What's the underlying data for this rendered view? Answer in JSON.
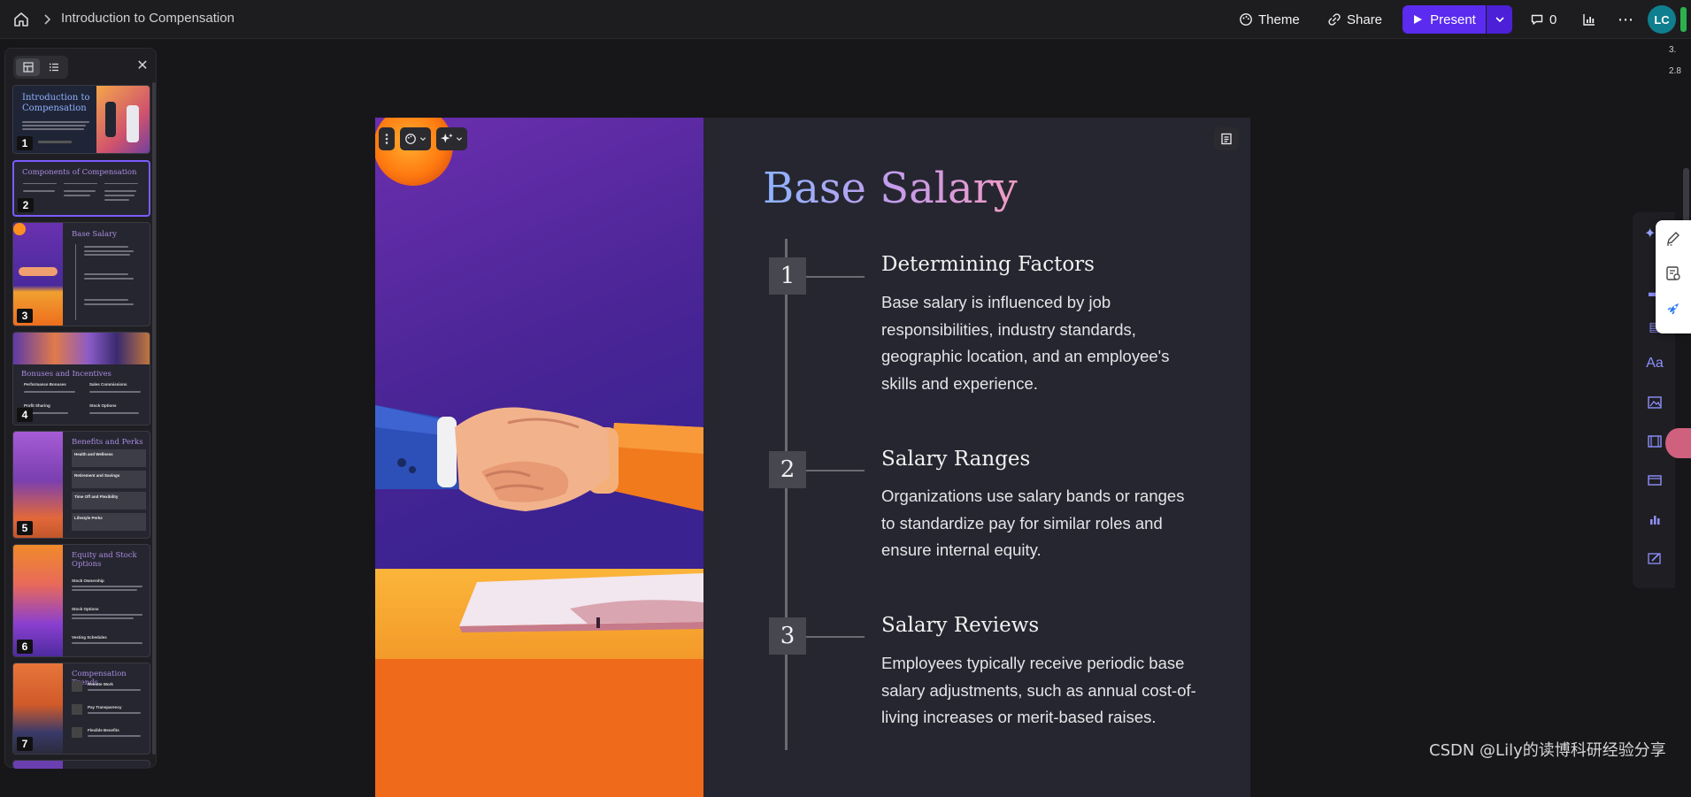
{
  "app": {
    "breadcrumb_title": "Introduction to Compensation",
    "theme_label": "Theme",
    "share_label": "Share",
    "present_label": "Present",
    "comments_count": "0",
    "avatar_initials": "LC",
    "accent_color": "#5b2bef",
    "mini_stats": [
      "3.",
      "2.8"
    ]
  },
  "sidebar": {
    "slides": [
      {
        "number": "1",
        "title": "Introduction to Compensation"
      },
      {
        "number": "2",
        "title": "Components of Compensation"
      },
      {
        "number": "3",
        "title": "Base Salary"
      },
      {
        "number": "4",
        "title": "Bonuses and Incentives"
      },
      {
        "number": "5",
        "title": "Benefits and Perks"
      },
      {
        "number": "6",
        "title": "Equity and Stock Options"
      },
      {
        "number": "7",
        "title": "Compensation Trends"
      }
    ],
    "thumb_details": {
      "s4_items": [
        "Performance Bonuses",
        "Sales Commissions",
        "Profit Sharing",
        "Stock Options"
      ],
      "s5_items": [
        "Health and Wellness",
        "Retirement and Savings",
        "Time Off and Flexibility",
        "Lifestyle Perks"
      ],
      "s6_items": [
        "Stock Ownership",
        "Stock Options",
        "Vesting Schedules"
      ],
      "s7_items": [
        "Remote Work",
        "Pay Transparency",
        "Flexible Benefits"
      ]
    }
  },
  "slide": {
    "title": "Base Salary",
    "items": [
      {
        "number": "1",
        "heading": "Determining Factors",
        "body": "Base salary is influenced by job responsibilities, industry standards, geographic location, and an employee's skills and experience."
      },
      {
        "number": "2",
        "heading": "Salary Ranges",
        "body": "Organizations use salary bands or ranges to standardize pay for similar roles and ensure internal equity."
      },
      {
        "number": "3",
        "heading": "Salary Reviews",
        "body": "Employees typically receive periodic base salary adjustments, such as annual cost-of-living increases or merit-based raises."
      }
    ]
  },
  "watermark": "CSDN @Lily的读博科研经验分享"
}
